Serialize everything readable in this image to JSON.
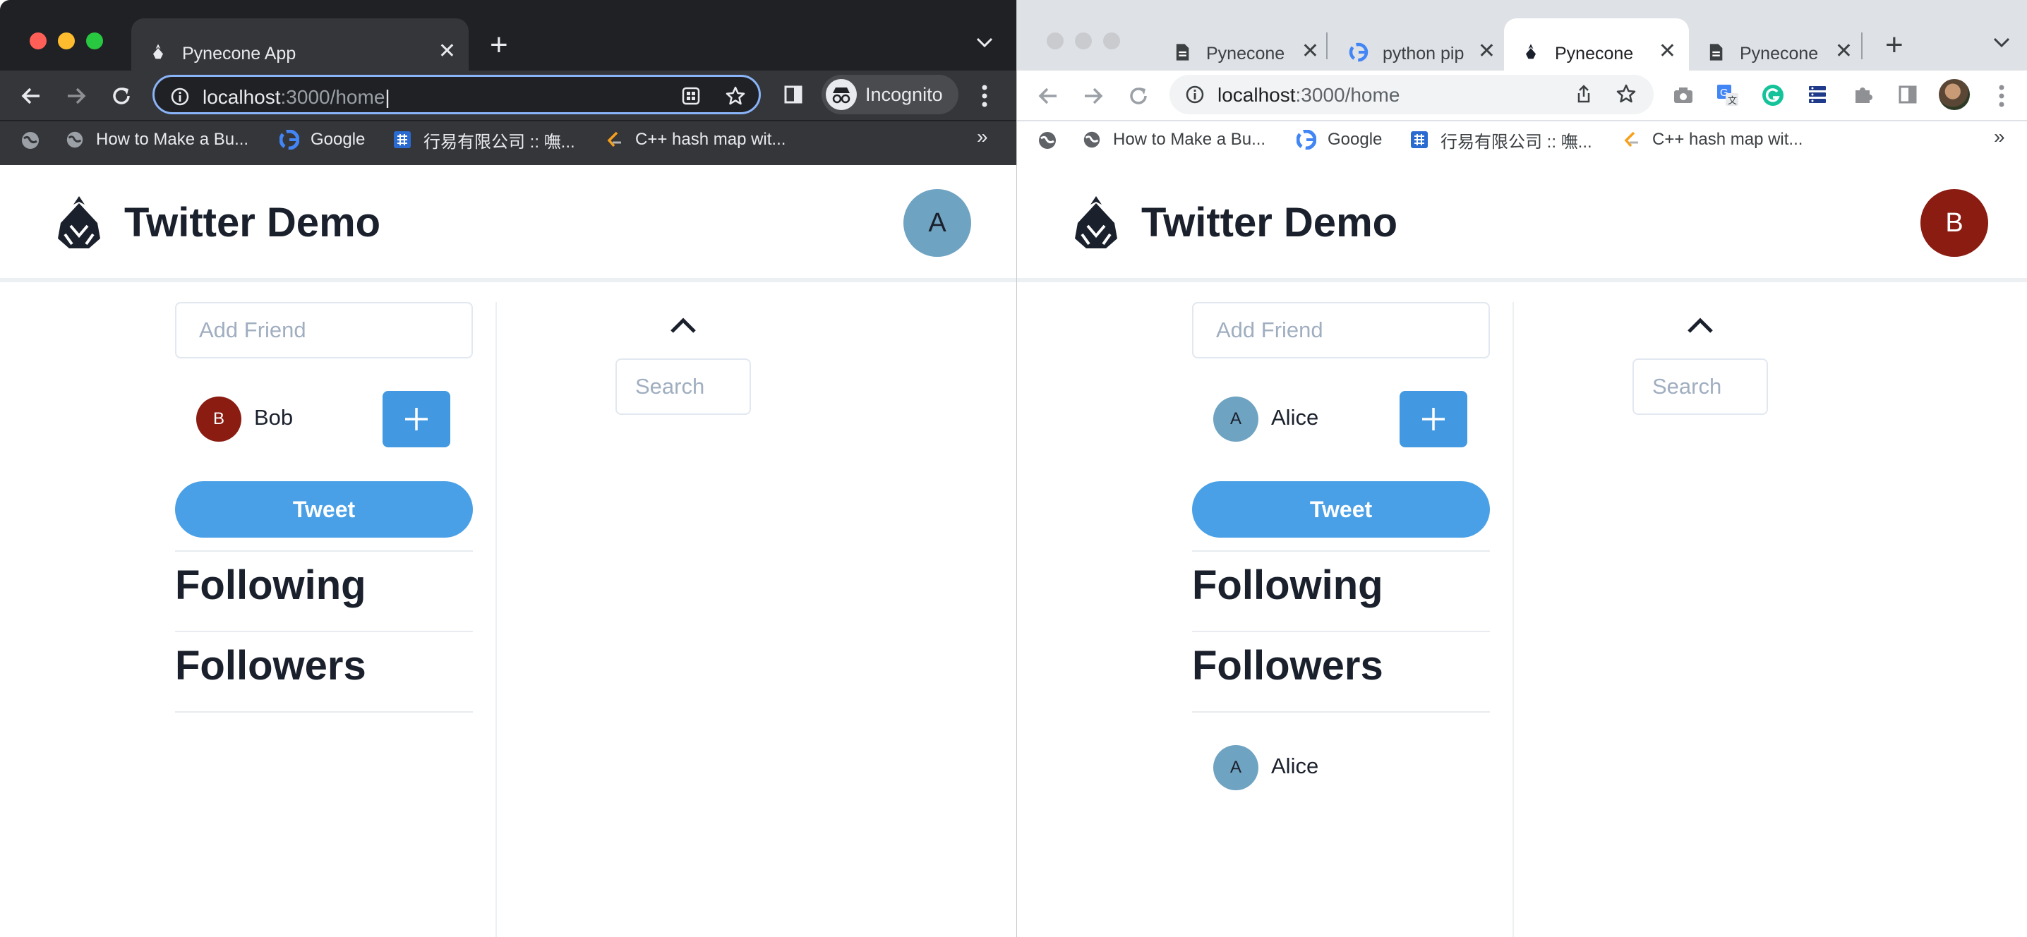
{
  "left_window": {
    "tab": {
      "title": "Pynecone App",
      "close": "✕"
    },
    "new_tab": "+",
    "address": {
      "host": "localhost",
      "path": ":3000/home"
    },
    "profile_label": "Incognito",
    "bookmarks": [
      "How to Make a Bu...",
      "Google",
      "行易有限公司 :: 嘸...",
      "C++ hash map wit..."
    ],
    "bookmarks_overflow": "»",
    "app": {
      "title": "Twitter Demo",
      "avatar_letter": "A",
      "add_friend_placeholder": "Add Friend",
      "friend_suggestion": {
        "letter": "B",
        "name": "Bob"
      },
      "tweet_label": "Tweet",
      "following_heading": "Following",
      "followers_heading": "Followers",
      "search_placeholder": "Search",
      "followers": []
    }
  },
  "right_window": {
    "tabs": [
      {
        "title": "Pynecone",
        "close": "✕"
      },
      {
        "title": "python pip",
        "close": "✕"
      },
      {
        "title": "Pynecone",
        "close": "✕"
      },
      {
        "title": "Pynecone",
        "close": "✕"
      }
    ],
    "new_tab": "+",
    "address": {
      "host": "localhost",
      "path": ":3000/home"
    },
    "bookmarks": [
      "How to Make a Bu...",
      "Google",
      "行易有限公司 :: 嘸...",
      "C++ hash map wit..."
    ],
    "bookmarks_overflow": "»",
    "app": {
      "title": "Twitter Demo",
      "avatar_letter": "B",
      "add_friend_placeholder": "Add Friend",
      "friend_suggestion": {
        "letter": "A",
        "name": "Alice"
      },
      "tweet_label": "Tweet",
      "following_heading": "Following",
      "followers_heading": "Followers",
      "search_placeholder": "Search",
      "followers": [
        {
          "letter": "A",
          "name": "Alice"
        }
      ]
    }
  },
  "colors": {
    "user_a": "#6fa3c2",
    "user_b": "#8b1c12",
    "accent_blue": "#4299e1",
    "incognito_frame": "#202124",
    "normal_frame": "#dee1e6",
    "focus_ring": "#8ab4f8"
  },
  "icons": [
    "pynecone-logo-icon",
    "back-arrow-icon",
    "forward-arrow-icon",
    "reload-icon",
    "info-icon",
    "star-icon",
    "incognito-icon",
    "menu-dots-icon",
    "globe-icon",
    "google-icon",
    "chevron-up-icon",
    "plus-icon",
    "doc-icon",
    "camera-icon",
    "translate-icon",
    "grammarly-icon",
    "extension-icon",
    "share-icon"
  ]
}
